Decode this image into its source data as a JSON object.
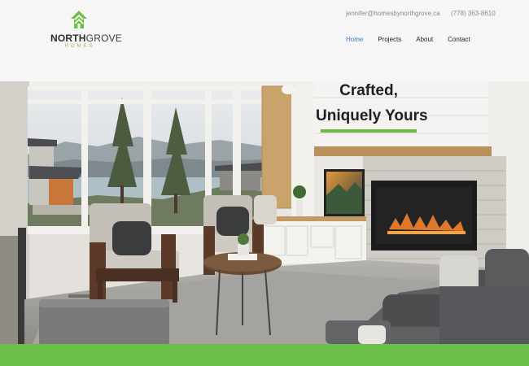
{
  "brand": {
    "name_part1": "NORTH",
    "name_part2": "GROVE",
    "tagline": "HOMES",
    "accent_color": "#6cbf4b"
  },
  "header": {
    "email": "jennifer@homesbynorthgrove.ca",
    "phone": "(778) 363-8610"
  },
  "nav": {
    "items": [
      {
        "label": "Home",
        "active": true
      },
      {
        "label": "Projects"
      },
      {
        "label": "About"
      },
      {
        "label": "Contact"
      }
    ],
    "active_color": "#3b7ac4"
  },
  "hero": {
    "title_line1": "Crafted,",
    "title_line2": "Uniquely Yours",
    "underline_color": "#6fb944"
  }
}
